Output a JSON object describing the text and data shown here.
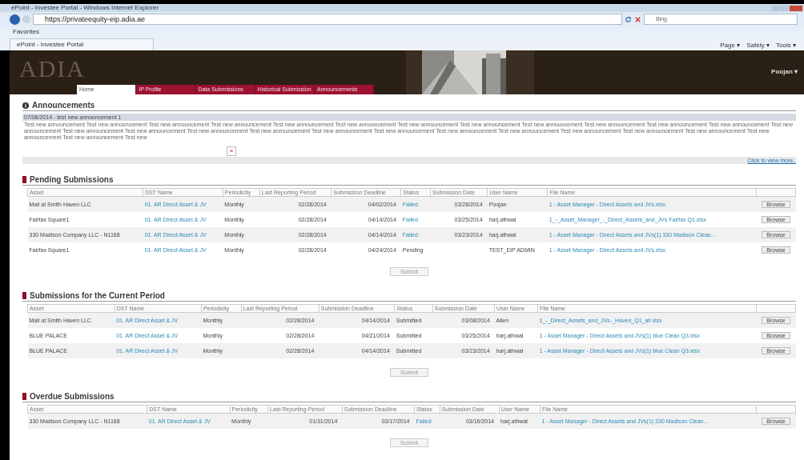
{
  "browser": {
    "title": "ePoint - Investee Portal - Windows Internet Explorer",
    "url": "https://privateequity-eip.adia.ae",
    "search": "Bing",
    "favorites": "Favorites",
    "tab": "ePoint - Investee Portal",
    "commands": [
      "Page ▾",
      "Safety ▾",
      "Tools ▾"
    ]
  },
  "header": {
    "logo": "ADIA",
    "user": "Poojan ▾",
    "nav": [
      {
        "label": "Home",
        "selected": true
      },
      {
        "label": "IP Profile",
        "selected": false
      },
      {
        "label": "Data Submissions",
        "selected": false
      },
      {
        "label": "Historical Submission",
        "selected": false
      },
      {
        "label": "Announcements",
        "selected": false
      }
    ]
  },
  "announcements": {
    "title": "Announcements",
    "heading": "07/08/2014 - test new announcement 1",
    "body": "Test new announcement Test new announcement Test new announcement Test new announcement Test new announcement Test new announcement Test new announcement Test new announcement Test new announcement Test new announcement Test new announcement Test new announcement Test new announcement Test new announcement Test new announcement Test new announcement Test new announcement Test new announcement Test new announcement Test new announcement Test new announcement Test new announcement Test new announcement Test new announcement Test new announcement Test new announcement Test new",
    "close": "×",
    "more": "Click to view more.."
  },
  "sections": [
    {
      "title": "Pending Submissions",
      "submit": "Submit",
      "columns": [
        "Asset",
        "DST Name",
        "Periodicity",
        "Last Reporting Period",
        "Submission Deadline",
        "Status",
        "Submission Date",
        "User Name",
        "File Name"
      ],
      "rows": [
        {
          "asset": "Mall at Smith Haven LLC",
          "dst": "01. AR Direct Asset & JV",
          "periodicity": "Monthly",
          "last": "02/28/2014",
          "deadline": "04/02/2014",
          "status": "Failed",
          "status_link": true,
          "date": "03/28/2014",
          "user": "Poojan",
          "file": "1 - Asset Manager - Direct Assets and JVs.xlsx",
          "action": "Browse"
        },
        {
          "asset": "Fairfax Square1",
          "dst": "01. AR Direct Asset & JV",
          "periodicity": "Monthly",
          "last": "02/28/2014",
          "deadline": "04/14/2014",
          "status": "Failed",
          "status_link": true,
          "date": "03/25/2014",
          "user": "harj.athwal",
          "file": "1_-_Asset_Manager_-_Direct_Assets_and_JVs Fairfax Q1.xlsx",
          "action": "Browse"
        },
        {
          "asset": "330 Madison Company LLC - N1168",
          "dst": "01. AR Direct Asset & JV",
          "periodicity": "Monthly",
          "last": "02/28/2014",
          "deadline": "04/14/2014",
          "status": "Failed",
          "status_link": true,
          "date": "03/23/2014",
          "user": "harj.athwal",
          "file": "1 - Asset Manager - Direct Assets and JVs(1) 330 Madison Clean...",
          "action": "Browse"
        },
        {
          "asset": "Fairfax Square1",
          "dst": "01. AR Direct Asset & JV",
          "periodicity": "Monthly",
          "last": "02/28/2014",
          "deadline": "04/24/2014",
          "status": "Pending",
          "status_link": false,
          "date": "",
          "user": "TEST_EIP ADMIN",
          "file": "1 - Asset Manager - Direct Assets and JVs.xlsx",
          "action": "Browse"
        }
      ]
    },
    {
      "title": "Submissions for the Current Period",
      "submit": "Submit",
      "columns": [
        "Asset",
        "DST Name",
        "Periodicity",
        "Last Reporting Period",
        "Submission Deadline",
        "Status",
        "Submission Date",
        "User Name",
        "File Name"
      ],
      "rows": [
        {
          "asset": "Mall at Smith Haven LLC",
          "dst": "01. AR Direct Asset & JV",
          "periodicity": "Monthly",
          "last": "02/28/2014",
          "deadline": "04/14/2014",
          "status": "Submitted",
          "status_link": false,
          "date": "03/08/2014",
          "user": "Allen",
          "file": "1_-_Direct_Assets_and_JVs-_Haven_Q1_all.xlsx",
          "action": "Browse"
        },
        {
          "asset": "BLUE PALACE",
          "dst": "01. AR Direct Asset & JV",
          "periodicity": "Monthly",
          "last": "02/28/2014",
          "deadline": "04/21/2014",
          "status": "Submitted",
          "status_link": false,
          "date": "03/25/2014",
          "user": "harj.athwal",
          "file": "1 - Asset Manager - Direct Assets and JVs(1) blue Clean Q3.xlsx",
          "action": "Browse"
        },
        {
          "asset": "BLUE PALACE",
          "dst": "01. AR Direct Asset & JV",
          "periodicity": "Monthly",
          "last": "02/28/2014",
          "deadline": "04/14/2014",
          "status": "Submitted",
          "status_link": false,
          "date": "03/23/2014",
          "user": "harj.athwal",
          "file": "1 - Asset Manager - Direct Assets and JVs(1) blue Clean Q3.xlsx",
          "action": "Browse"
        }
      ]
    },
    {
      "title": "Overdue Submissions",
      "submit": "Submit",
      "columns": [
        "Asset",
        "DST Name",
        "Periodicity",
        "Last Reporting Period",
        "Submission Deadline",
        "Status",
        "Submission Date",
        "User Name",
        "File Name"
      ],
      "rows": [
        {
          "asset": "330 Madison Company LLC - N1168",
          "dst": "01. AR Direct Asset & JV",
          "periodicity": "Monthly",
          "last": "01/31/2014",
          "deadline": "03/17/2014",
          "status": "Failed",
          "status_link": true,
          "date": "03/16/2014",
          "user": "harj.athwal",
          "file": "1 - Asset Manager - Direct Assets and JVs(1) 330 Madison Clean...",
          "action": "Browse"
        }
      ]
    }
  ]
}
